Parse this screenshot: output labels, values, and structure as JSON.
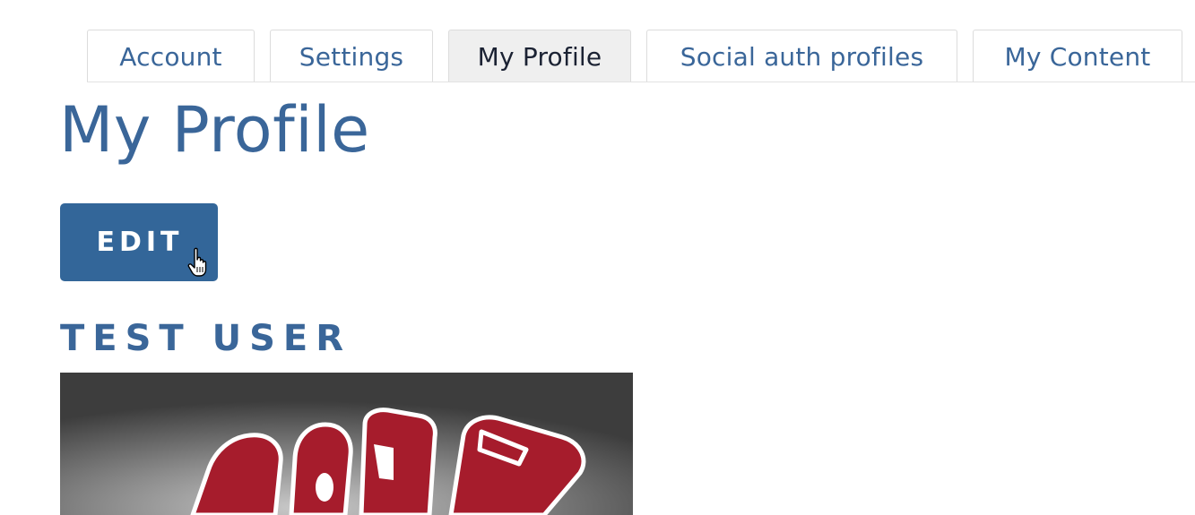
{
  "tabs": [
    {
      "label": "Account",
      "active": false
    },
    {
      "label": "Settings",
      "active": false
    },
    {
      "label": "My Profile",
      "active": true
    },
    {
      "label": "Social auth profiles",
      "active": false
    },
    {
      "label": "My Content",
      "active": false
    }
  ],
  "page": {
    "title": "My Profile",
    "edit_label": "EDIT",
    "user_name": "TEST USER"
  },
  "colors": {
    "accent": "#336699",
    "link": "#3a6699",
    "active_tab_bg": "#efefef",
    "active_tab_text": "#1b2233",
    "image_red": "#a61c2c"
  },
  "icons": {
    "cursor": "hand-pointer-icon"
  }
}
